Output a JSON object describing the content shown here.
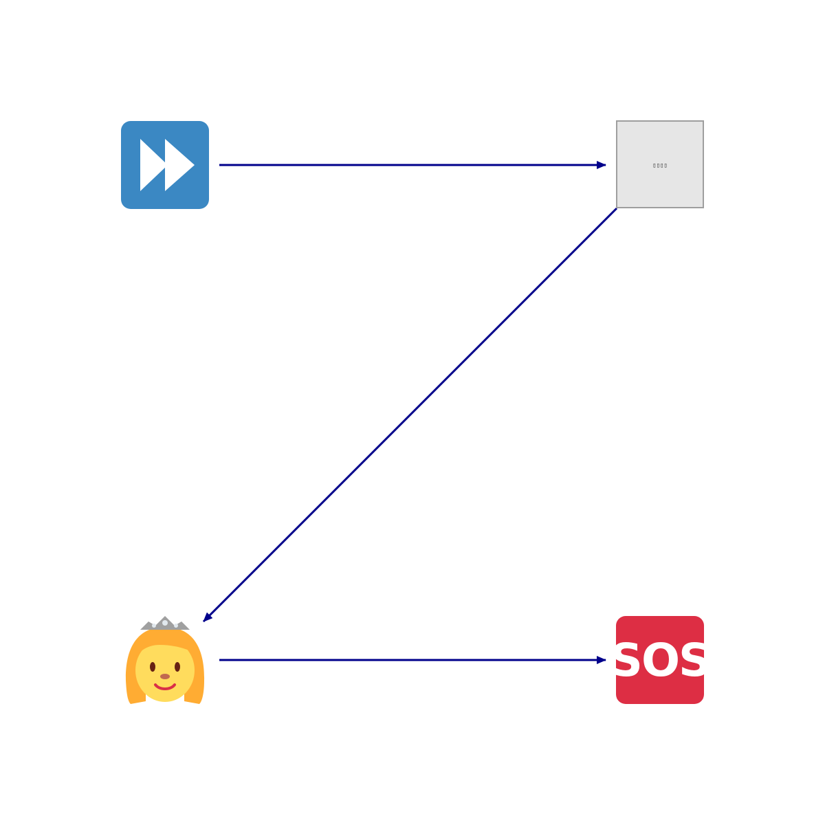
{
  "diagram": {
    "nodes": [
      {
        "id": "fast-forward",
        "icon": "fast-forward-icon",
        "color": "#3B88C3",
        "glyph_color": "#FFFFFF"
      },
      {
        "id": "placeholder-box",
        "icon": "missing-glyph-icon",
        "color": "#E6E6E6",
        "border_color": "#9E9E9E",
        "label": "▯▯▯▯"
      },
      {
        "id": "princess",
        "icon": "princess-icon",
        "hair_color": "#FFAC33",
        "skin_color": "#FFDC5D",
        "tiara_color": "#A0A0A0"
      },
      {
        "id": "sos",
        "icon": "sos-icon",
        "color": "#DD2E44",
        "label": "SOS"
      }
    ],
    "edges": [
      {
        "from": "fast-forward",
        "to": "placeholder-box"
      },
      {
        "from": "placeholder-box",
        "to": "princess"
      },
      {
        "from": "princess",
        "to": "sos"
      }
    ],
    "edge_color": "#00008B"
  }
}
